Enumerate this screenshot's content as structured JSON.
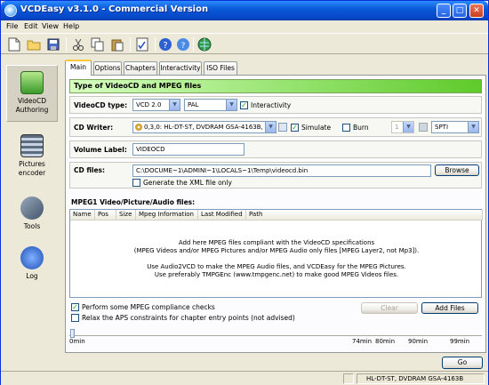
{
  "window": {
    "title": "VCDEasy v3.1.0 - Commercial Version"
  },
  "menu": {
    "items": [
      "File",
      "Edit",
      "View",
      "Help"
    ]
  },
  "toolbar": {
    "icons": [
      "new-file-icon",
      "open-folder-icon",
      "save-icon",
      "cut-icon",
      "copy-icon",
      "paste-icon",
      "checklist-icon",
      "help-question-icon",
      "help-about-icon",
      "web-globe-icon"
    ]
  },
  "nav": {
    "items": [
      {
        "label1": "VideoCD",
        "label2": "Authoring",
        "icon": "videocd-icon"
      },
      {
        "label1": "Pictures",
        "label2": "encoder",
        "icon": "film-icon"
      },
      {
        "label1": "Tools",
        "label2": "",
        "icon": "tools-icon"
      },
      {
        "label1": "Log",
        "label2": "",
        "icon": "log-icon"
      }
    ]
  },
  "tabs": [
    "Main",
    "Options",
    "Chapters",
    "Interactivity",
    "ISO Files"
  ],
  "main": {
    "banner": "Type of VideoCD and MPEG files",
    "vcd_type_label": "VideoCD type:",
    "vcd_type_value": "VCD 2.0",
    "standard_value": "PAL",
    "interactivity_label": "Interactivity",
    "writer_label": "CD Writer:",
    "writer_value": "0,3,0: HL-DT-ST, DVDRAM GSA-4163B,",
    "simulate_label": "Simulate",
    "burn_label": "Burn",
    "speed_value": "1",
    "interface_value": "SPTI",
    "volume_label": "Volume Label:",
    "volume_value": "VIDEOCD",
    "cdfiles_label": "CD files:",
    "cdfiles_value": "C:\\DOCUME~1\\ADMINI~1\\LOCALS~1\\Temp\\videocd.bin",
    "browse_label": "Browse",
    "xml_label": "Generate the XML file only",
    "mpeg_section": "MPEG1 Video/Picture/Audio files:",
    "columns": [
      "Name",
      "Pos",
      "Size",
      "Mpeg Information",
      "Last Modified",
      "Path"
    ],
    "grid_msg": [
      "Add here MPEG files compliant with the VideoCD specifications",
      "(MPEG Videos and/or MPEG Pictures and/or MPEG Audio only files [MPEG Layer2, not Mp3]).",
      "",
      "Use Audio2VCD to make the MPEG Audio files, and VCDEasy for the MPEG Pictures.",
      "Use preferably TMPGEnc (www.tmpgenc.net) to make good MPEG Videos files."
    ],
    "compliance_label": "Perform some MPEG compliance checks",
    "relax_label": "Relax the APS constraints for chapter entry points (not advised)",
    "clear_label": "Clear",
    "addfiles_label": "Add Files",
    "ticks": [
      "0min",
      "74min",
      "80min",
      "90min",
      "99min"
    ]
  },
  "go_label": "Go",
  "status": {
    "drive": "HL-DT-ST, DVDRAM GSA-4163B"
  }
}
